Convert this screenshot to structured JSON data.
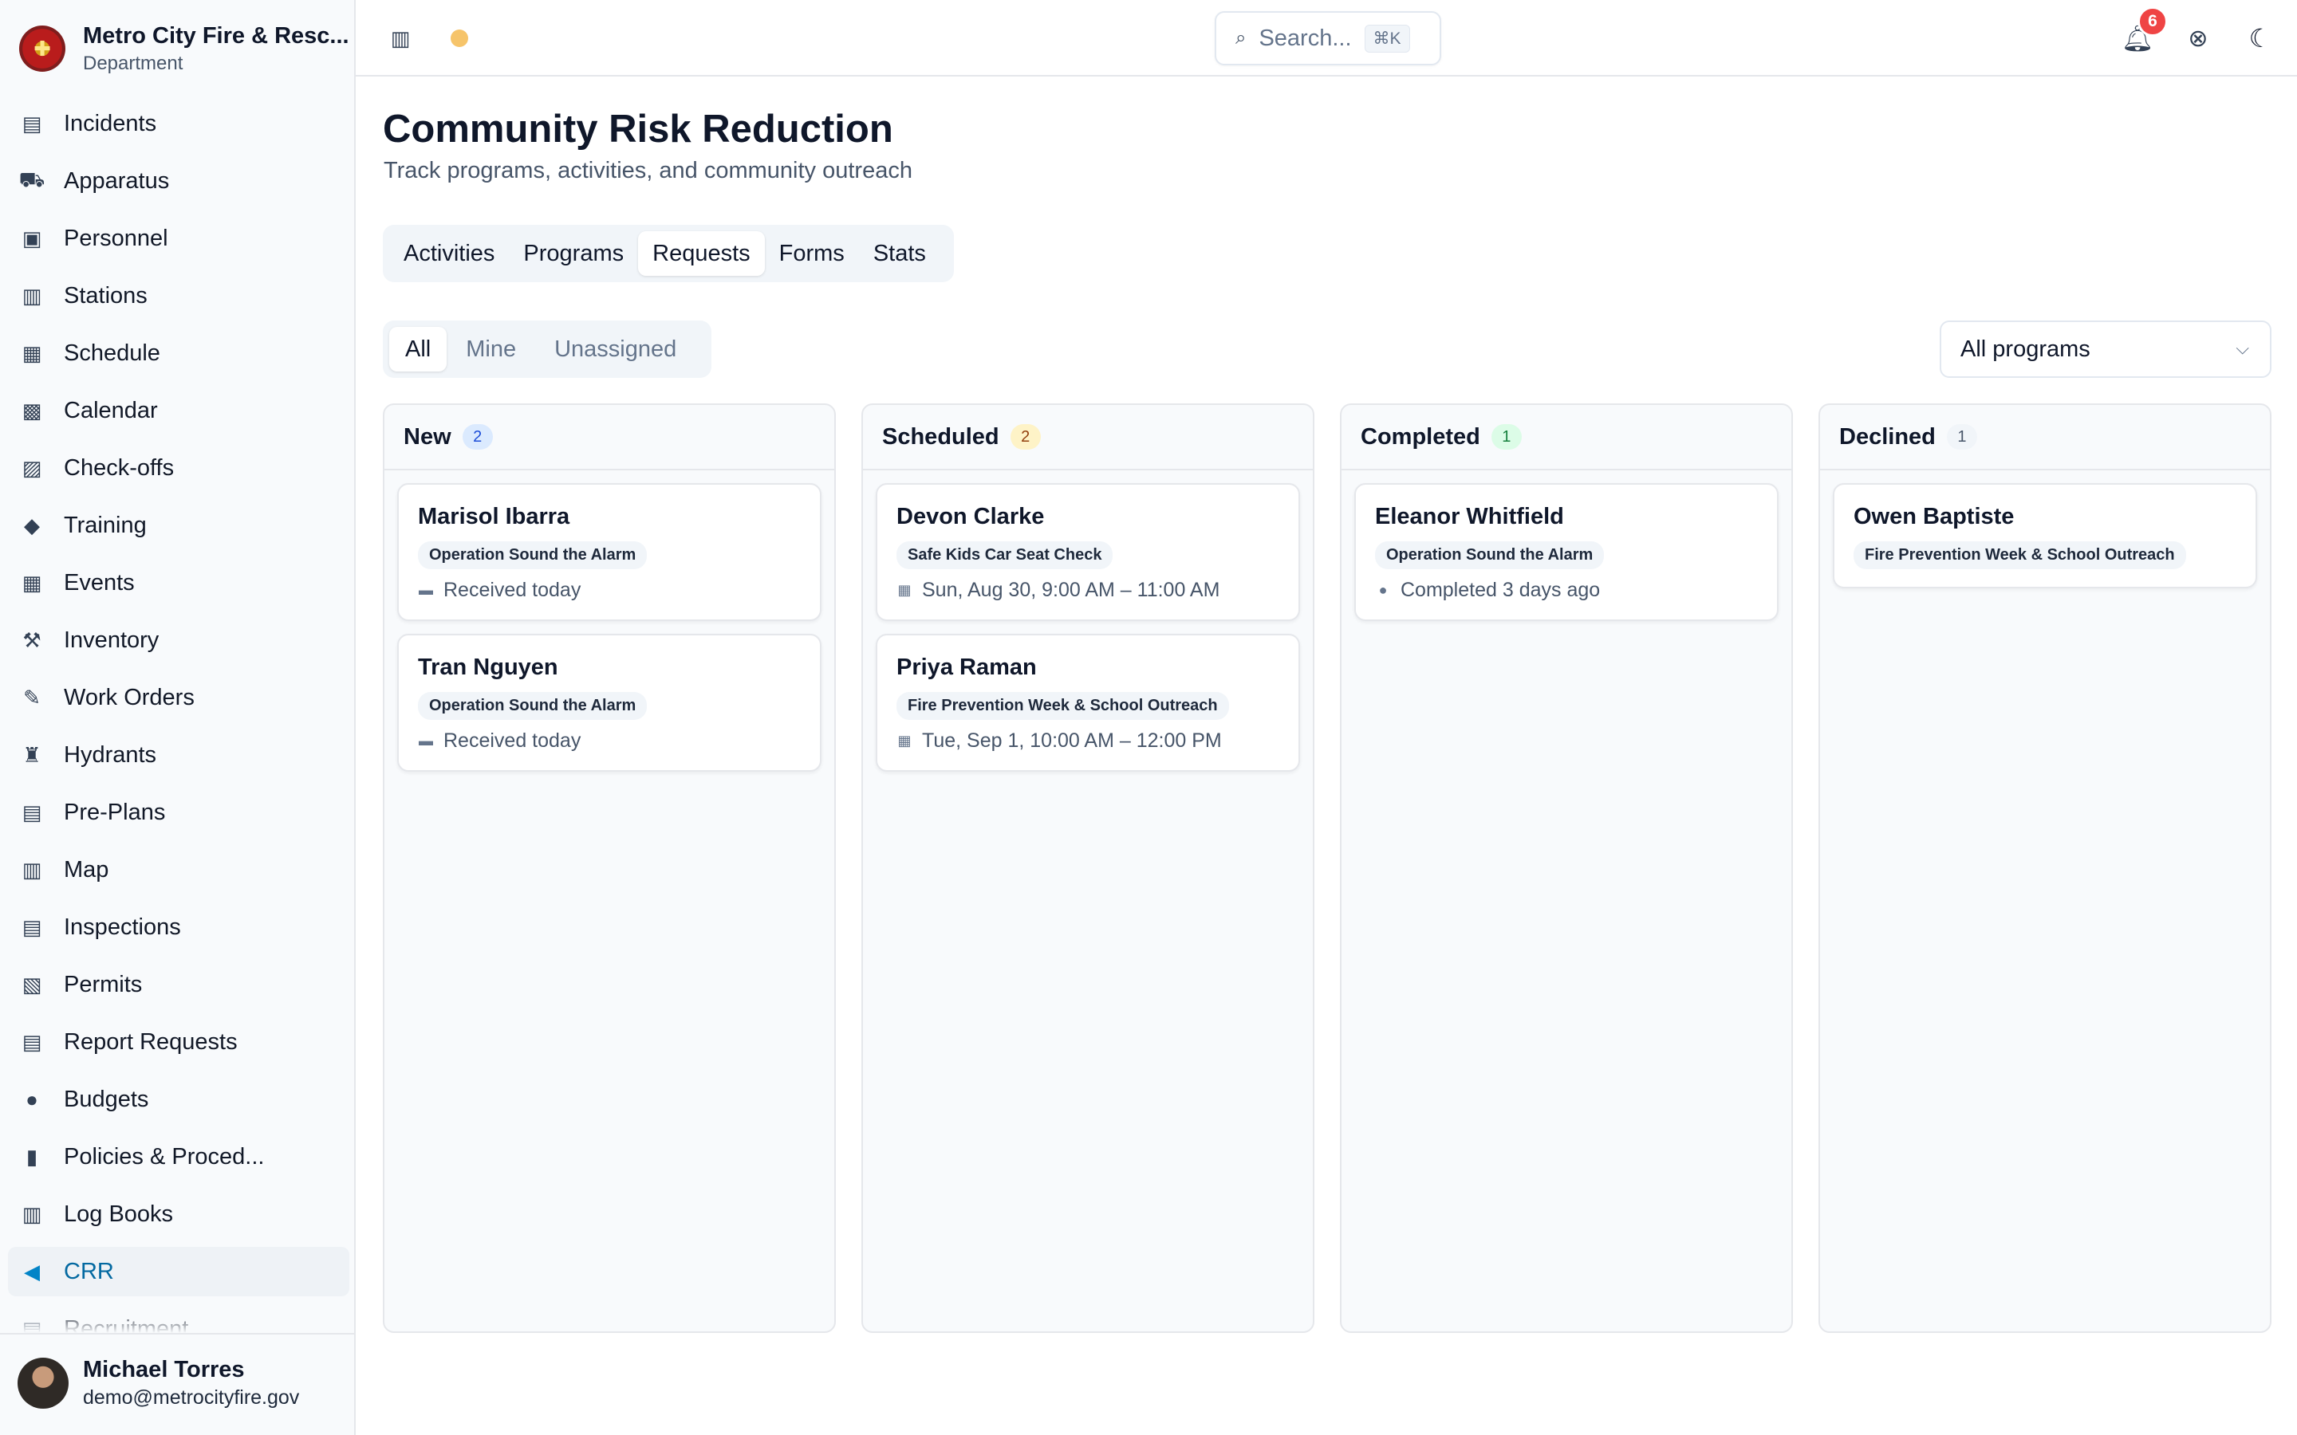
{
  "org": {
    "name": "Metro City Fire & Resc...",
    "sub": "Department"
  },
  "sidebar": {
    "items": [
      {
        "label": "Incidents",
        "icon": "incidents-icon",
        "glyph": "▤"
      },
      {
        "label": "Apparatus",
        "icon": "truck-icon",
        "glyph": "⛟"
      },
      {
        "label": "Personnel",
        "icon": "id-card-icon",
        "glyph": "▣"
      },
      {
        "label": "Stations",
        "icon": "building-icon",
        "glyph": "▥"
      },
      {
        "label": "Schedule",
        "icon": "calendar-grid-icon",
        "glyph": "▦"
      },
      {
        "label": "Calendar",
        "icon": "calendar-icon",
        "glyph": "▩"
      },
      {
        "label": "Check-offs",
        "icon": "clipboard-check-icon",
        "glyph": "▨"
      },
      {
        "label": "Training",
        "icon": "graduation-cap-icon",
        "glyph": "◆"
      },
      {
        "label": "Events",
        "icon": "calendar-event-icon",
        "glyph": "▦"
      },
      {
        "label": "Inventory",
        "icon": "hammer-icon",
        "glyph": "⚒"
      },
      {
        "label": "Work Orders",
        "icon": "wrench-icon",
        "glyph": "✎"
      },
      {
        "label": "Hydrants",
        "icon": "hydrant-icon",
        "glyph": "♜"
      },
      {
        "label": "Pre-Plans",
        "icon": "building-plan-icon",
        "glyph": "▤"
      },
      {
        "label": "Map",
        "icon": "map-icon",
        "glyph": "▥"
      },
      {
        "label": "Inspections",
        "icon": "clipboard-list-icon",
        "glyph": "▤"
      },
      {
        "label": "Permits",
        "icon": "permit-icon",
        "glyph": "▧"
      },
      {
        "label": "Report Requests",
        "icon": "report-icon",
        "glyph": "▤"
      },
      {
        "label": "Budgets",
        "icon": "piggy-bank-icon",
        "glyph": "●"
      },
      {
        "label": "Policies & Proced...",
        "icon": "binder-icon",
        "glyph": "▮"
      },
      {
        "label": "Log Books",
        "icon": "books-icon",
        "glyph": "▥"
      },
      {
        "label": "CRR",
        "icon": "megaphone-icon",
        "glyph": "◀"
      },
      {
        "label": "Recruitment",
        "icon": "recruitment-icon",
        "glyph": "▤"
      }
    ],
    "active": "CRR"
  },
  "user": {
    "name": "Michael Torres",
    "email": "demo@metrocityfire.gov"
  },
  "topbar": {
    "search_placeholder": "Search...",
    "search_shortcut": "⌘K",
    "notification_count": "6"
  },
  "page": {
    "title": "Community Risk Reduction",
    "subtitle": "Track programs, activities, and community outreach"
  },
  "tabs": [
    {
      "label": "Activities",
      "active": false
    },
    {
      "label": "Programs",
      "active": false
    },
    {
      "label": "Requests",
      "active": true
    },
    {
      "label": "Forms",
      "active": false
    },
    {
      "label": "Stats",
      "active": false
    }
  ],
  "filters": {
    "segments": [
      {
        "label": "All",
        "active": true
      },
      {
        "label": "Mine",
        "active": false
      },
      {
        "label": "Unassigned",
        "active": false
      }
    ],
    "program_select": "All programs"
  },
  "board": {
    "columns": [
      {
        "title": "New",
        "count": "2",
        "count_style": "blue",
        "cards": [
          {
            "name": "Marisol Ibarra",
            "program": "Operation Sound the Alarm",
            "meta_icon": "inbox-icon",
            "meta": "Received today"
          },
          {
            "name": "Tran Nguyen",
            "program": "Operation Sound the Alarm",
            "meta_icon": "inbox-icon",
            "meta": "Received today"
          }
        ]
      },
      {
        "title": "Scheduled",
        "count": "2",
        "count_style": "amber",
        "cards": [
          {
            "name": "Devon Clarke",
            "program": "Safe Kids Car Seat Check",
            "meta_icon": "calendar-icon",
            "meta": "Sun, Aug 30, 9:00 AM – 11:00 AM"
          },
          {
            "name": "Priya Raman",
            "program": "Fire Prevention Week & School Outreach",
            "meta_icon": "calendar-icon",
            "meta": "Tue, Sep 1, 10:00 AM – 12:00 PM"
          }
        ]
      },
      {
        "title": "Completed",
        "count": "1",
        "count_style": "green",
        "cards": [
          {
            "name": "Eleanor Whitfield",
            "program": "Operation Sound the Alarm",
            "meta_icon": "check-circle-icon",
            "meta": "Completed 3 days ago"
          }
        ]
      },
      {
        "title": "Declined",
        "count": "1",
        "count_style": "gray",
        "cards": [
          {
            "name": "Owen Baptiste",
            "program": "Fire Prevention Week & School Outreach"
          }
        ]
      }
    ]
  },
  "colors": {
    "accent": "#0284c7",
    "badge_red": "#ef4444",
    "status_dot": "#f6c46a"
  }
}
